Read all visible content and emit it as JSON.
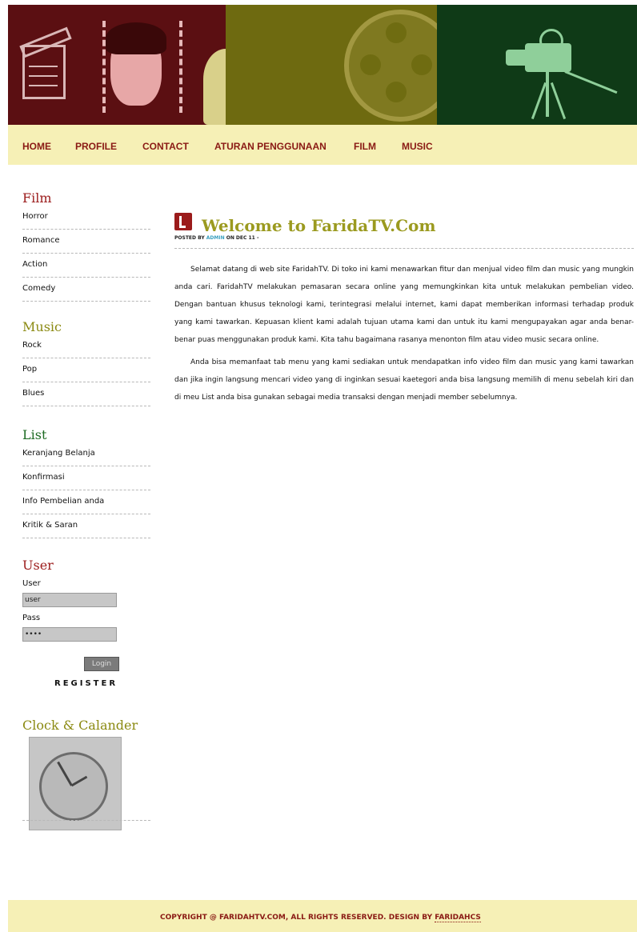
{
  "nav": {
    "items": [
      "HOME",
      "PROFILE",
      "CONTACT",
      "ATURAN PENGGUNAAN",
      "FILM",
      "MUSIC"
    ]
  },
  "sidebar": {
    "film": {
      "title": "Film",
      "items": [
        "Horror",
        "Romance",
        "Action",
        "Comedy"
      ]
    },
    "music": {
      "title": "Music",
      "items": [
        "Rock",
        "Pop",
        "Blues"
      ]
    },
    "list": {
      "title": "List",
      "items": [
        "Keranjang Belanja",
        "Konfirmasi",
        "Info Pembelian anda",
        "Kritik & Saran"
      ]
    },
    "user": {
      "title": "User",
      "user_label": "User",
      "user_value": "user",
      "pass_label": "Pass",
      "pass_value": "••••",
      "login_label": "Login",
      "register_label": "REGISTER"
    },
    "clock": {
      "title": "Clock & Calander"
    }
  },
  "post": {
    "title": "Welcome to FaridaTV.Com",
    "meta_prefix": "POSTED BY",
    "meta_author": "ADMIN",
    "meta_suffix": "ON DEC 11 -",
    "paragraphs": [
      "Selamat datang di web site FaridahTV. Di toko ini kami menawarkan fitur dan menjual video film dan music yang mungkin anda cari. FaridahTV melakukan pemasaran secara online yang memungkinkan kita untuk melakukan pembelian video. Dengan bantuan khusus teknologi kami, terintegrasi melalui internet, kami dapat memberikan informasi terhadap produk yang kami tawarkan. Kepuasan klient kami adalah tujuan utama kami dan untuk itu kami mengupayakan agar anda benar-benar puas menggunakan produk kami. Kita tahu bagaimana rasanya menonton film atau video music secara online.",
      "Anda bisa memanfaat tab menu yang kami sediakan untuk mendapatkan info video film dan music yang kami tawarkan dan jika ingin langsung mencari video yang di inginkan sesuai kaetegori anda bisa langsung memilih di menu sebelah kiri dan di meu List anda bisa gunakan sebagai media transaksi dengan menjadi member sebelumnya."
    ]
  },
  "footer": {
    "text": "COPYRIGHT @ FARIDAHTV.COM, ALL RIGHTS RESERVED. DESIGN BY ",
    "by": "FARIDAHCS"
  },
  "colors": {
    "banner_left": "#5b0f12",
    "banner_mid": "#6e6a10",
    "banner_right": "#0f3a17",
    "nav_bg": "#f6f0b6",
    "nav_text": "#8a1a14"
  }
}
